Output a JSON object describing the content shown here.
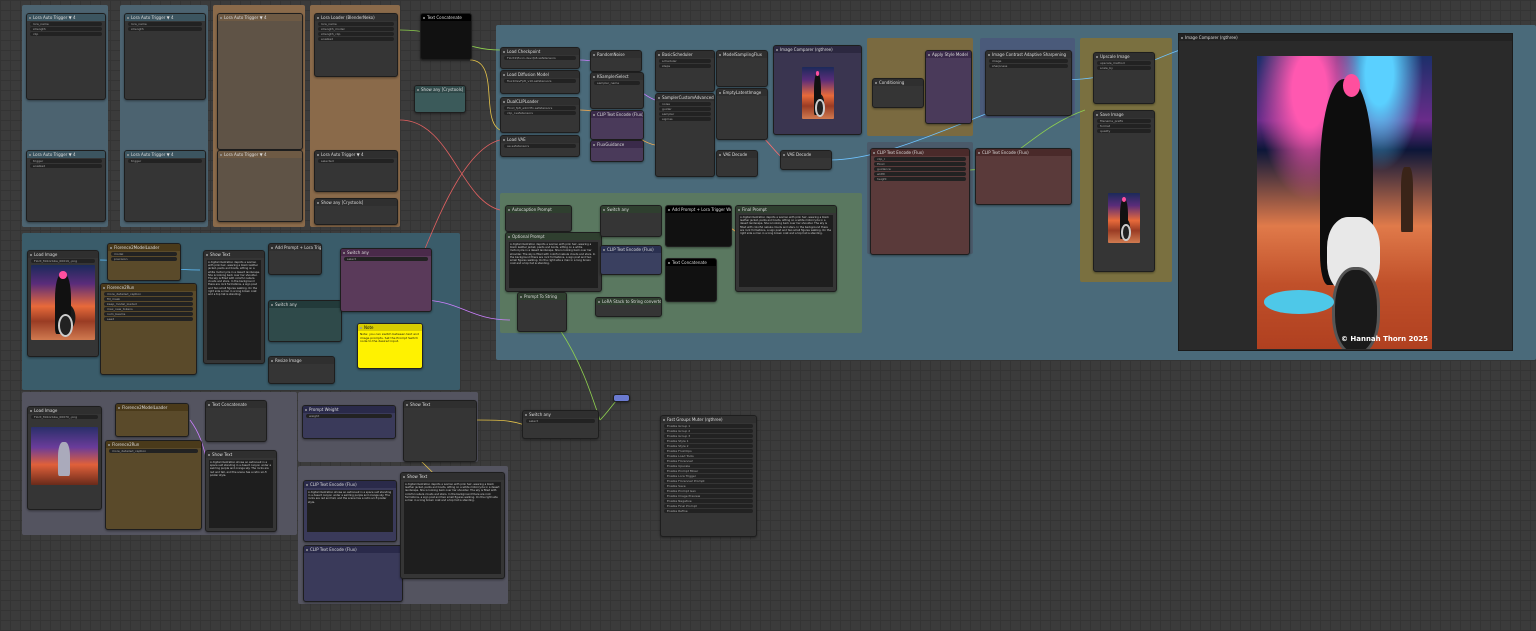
{
  "nodes": {
    "lora_loader": {
      "title": "Lora Loader (BlenderNeko)",
      "badge": "Lora Auto Trigger ▼ 4"
    },
    "text_concat": {
      "title": "Text Concatenate",
      "badge": "was-node-suite ▼"
    },
    "lora_trigger_words": {
      "title": "Lora Auto Trigger ▼ 4"
    },
    "show_any": {
      "title": "Show any [Crystools]"
    },
    "load_checkpoint": {
      "title": "Load Checkpoint",
      "w1": "FLUX1\\flux1-dev-fp8.safetensors"
    },
    "load_diffusion": {
      "title": "Load Diffusion Model",
      "w1": "flux1DevFp8_v10.safetensors"
    },
    "dual_clip": {
      "title": "DualCLIPLoader",
      "w1": "t5xxl_fp8_e4m3fn.safetensors",
      "w2": "clip_l.safetensors"
    },
    "load_vae": {
      "title": "Load VAE",
      "w1": "ae.safetensors"
    },
    "random_noise": {
      "title": "RandomNoise"
    },
    "ksampler_select": {
      "title": "KSamplerSelect"
    },
    "sampler_custom": {
      "title": "SamplerCustomAdvanced"
    },
    "basic_scheduler": {
      "title": "BasicScheduler"
    },
    "vae_decode": {
      "title": "VAE Decode"
    },
    "image_preview": {
      "title": "Image Comparer (rgthree)"
    },
    "autocaption": {
      "title": "Autocaption Prompt"
    },
    "user_prompt": {
      "title": "Optional Prompt"
    },
    "lora_trigger": {
      "title": "Add Prompt + Lora Trigger Words"
    },
    "final_prompt": {
      "title": "Final Prompt"
    },
    "ipadapter": {
      "title": "Image Contrast Adaptive Sharpening"
    },
    "upscale": {
      "title": "Upscale Image"
    },
    "florence_load": {
      "title": "Load Image",
      "file": "FLUX_Motorbike_00019_.png"
    },
    "florence_model": {
      "title": "Florence2ModelLoader"
    },
    "florence_run": {
      "title": "Florence2Run",
      "task": "more_detailed_caption"
    },
    "show_text": {
      "title": "Show Text"
    },
    "note": {
      "title": "Note",
      "text": "Note: you can switch between text and image prompts. Set the Prompt Switch node to the desired input."
    },
    "load_image_2": {
      "title": "Load Image",
      "file": "FLUX_Motorbike_00070_.png"
    },
    "prompt_weight": {
      "title": "Prompt Weight"
    },
    "clip_text": {
      "title": "CLIP Text Encode (Flux)"
    },
    "switch_any": {
      "title": "Switch any"
    },
    "fast_bypasser": {
      "title": "Fast Groups Muter (rgthree)"
    },
    "save_image": {
      "title": "Image Comparer (rgthree)"
    }
  },
  "bypasser_items": [
    "Enable Group 1",
    "Enable Group 2",
    "Enable Group 3",
    "Enable Style 1",
    "Enable Style 2",
    "Enable FluxClips",
    "Enable Load Tools",
    "Enable Florence2",
    "Enable Upscale",
    "Enable Prompt Mixer",
    "Enable Lora Trigger",
    "Enable Florence2 Prompt",
    "Enable Save",
    "Enable Prompt Gen",
    "Enable Image Preview",
    "Enable Negative",
    "Enable Final Prompt",
    "Enable Refine"
  ],
  "copyright": "© Hannah Thorn 2025",
  "caption_text": "A digital illustration depicts a woman with pink hair, wearing a black leather jacket, pants and boots, sitting on a white motorcycle in a desert landscape. She is looking back over her shoulder. The sky is filled with colorful nebula clouds and stars. In the background there are rock formations, a sign post and two small figures walking. On the right side a man in a long brown coat and a top hat is standing.",
  "caption_text_2": "A digital illustration shows an astronaut in a space suit standing in a desert canyon under a swirling purple and orange sky. The rocks are red and tall, and the scene has a retro sci-fi poster style."
}
